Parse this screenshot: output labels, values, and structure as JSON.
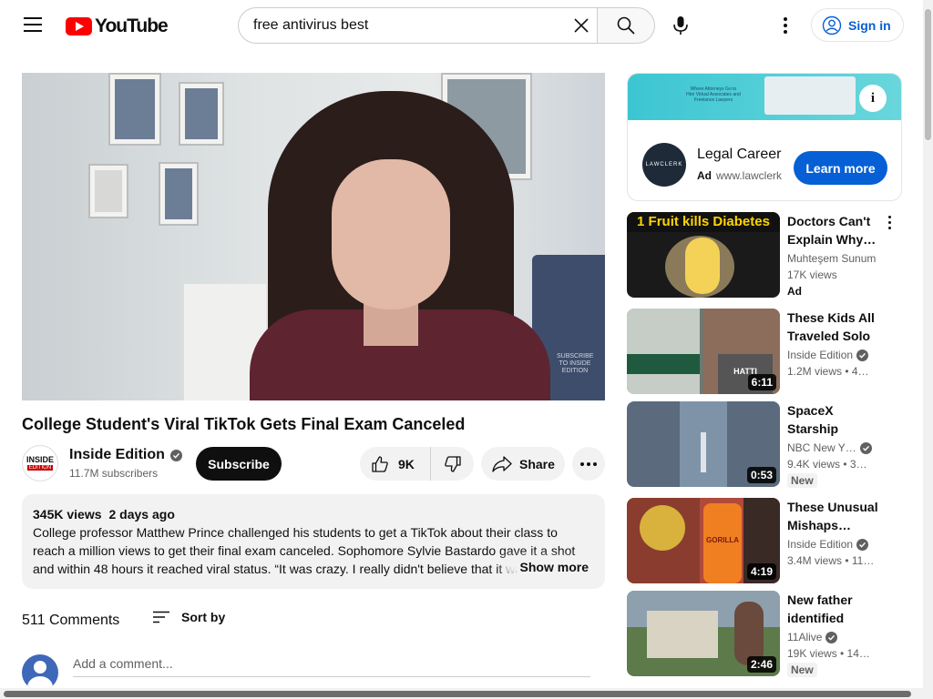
{
  "header": {
    "logo_text": "YouTube",
    "search_value": "free antivirus best",
    "signin_label": "Sign in"
  },
  "video": {
    "title": "College Student's Viral TikTok Gets Final Exam Canceled",
    "watermark_text": "SUBSCRIBE TO INSIDE EDITION"
  },
  "channel": {
    "avatar_line1": "INSIDE",
    "avatar_line2": "EDITION",
    "name": "Inside Edition",
    "subscribers": "11.7M subscribers",
    "subscribe_label": "Subscribe"
  },
  "actions": {
    "likes": "9K",
    "share_label": "Share"
  },
  "description": {
    "views": "345K views",
    "date": "2 days ago",
    "text": "College professor Matthew Prince challenged his students to get a TikTok about their class to reach a million views to get their final exam canceled. Sophomore Sylvie Bastardo gave it a shot and within 48 hours it reached viral status. “It was crazy. I really didn't believe that it was",
    "show_more": "Show more"
  },
  "comments": {
    "count": "511 Comments",
    "sort_label": "Sort by",
    "placeholder": "Add a comment..."
  },
  "ad": {
    "banner_text": "Where Attorneys Go to Hire Virtual Associates and Freelance Lawyers",
    "logo_text": "LAWCLERK",
    "title": "Legal Career",
    "ad_label": "Ad",
    "url": "www.lawclerk",
    "cta": "Learn more"
  },
  "recommended": [
    {
      "thumb_text": "1 Fruit kills Diabetes",
      "title": "Doctors Can't Explain Why…",
      "channel": "Muhteşem Sunum",
      "meta": "17K views",
      "badge": "Ad",
      "duration": ""
    },
    {
      "title": "These Kids All Traveled Solo",
      "channel": "Inside Edition",
      "meta": "1.2M views • 4…",
      "duration": "6:11",
      "thumb_text": "HATTI"
    },
    {
      "title": "SpaceX Starship Rock…",
      "channel": "NBC New Y…",
      "meta": "9.4K views • 3…",
      "badge": "New",
      "duration": "0:53"
    },
    {
      "title": "These Unusual Mishaps…",
      "channel": "Inside Edition",
      "meta": "3.4M views • 11…",
      "duration": "4:19",
      "thumb_text": "GORILLA"
    },
    {
      "title": "New father identified afte…",
      "channel": "11Alive",
      "meta": "19K views • 14…",
      "badge": "New",
      "duration": "2:46"
    }
  ],
  "colors": {
    "brand_red": "#ff0000",
    "link_blue": "#065fd4",
    "text_primary": "#0f0f0f",
    "text_secondary": "#606060",
    "chip_bg": "#f2f2f2"
  },
  "icons": [
    "menu-icon",
    "search-icon",
    "clear-icon",
    "mic-icon",
    "more-vert-icon",
    "account-icon",
    "verified-icon",
    "thumb-up-icon",
    "thumb-down-icon",
    "share-icon",
    "sort-icon",
    "info-icon"
  ]
}
